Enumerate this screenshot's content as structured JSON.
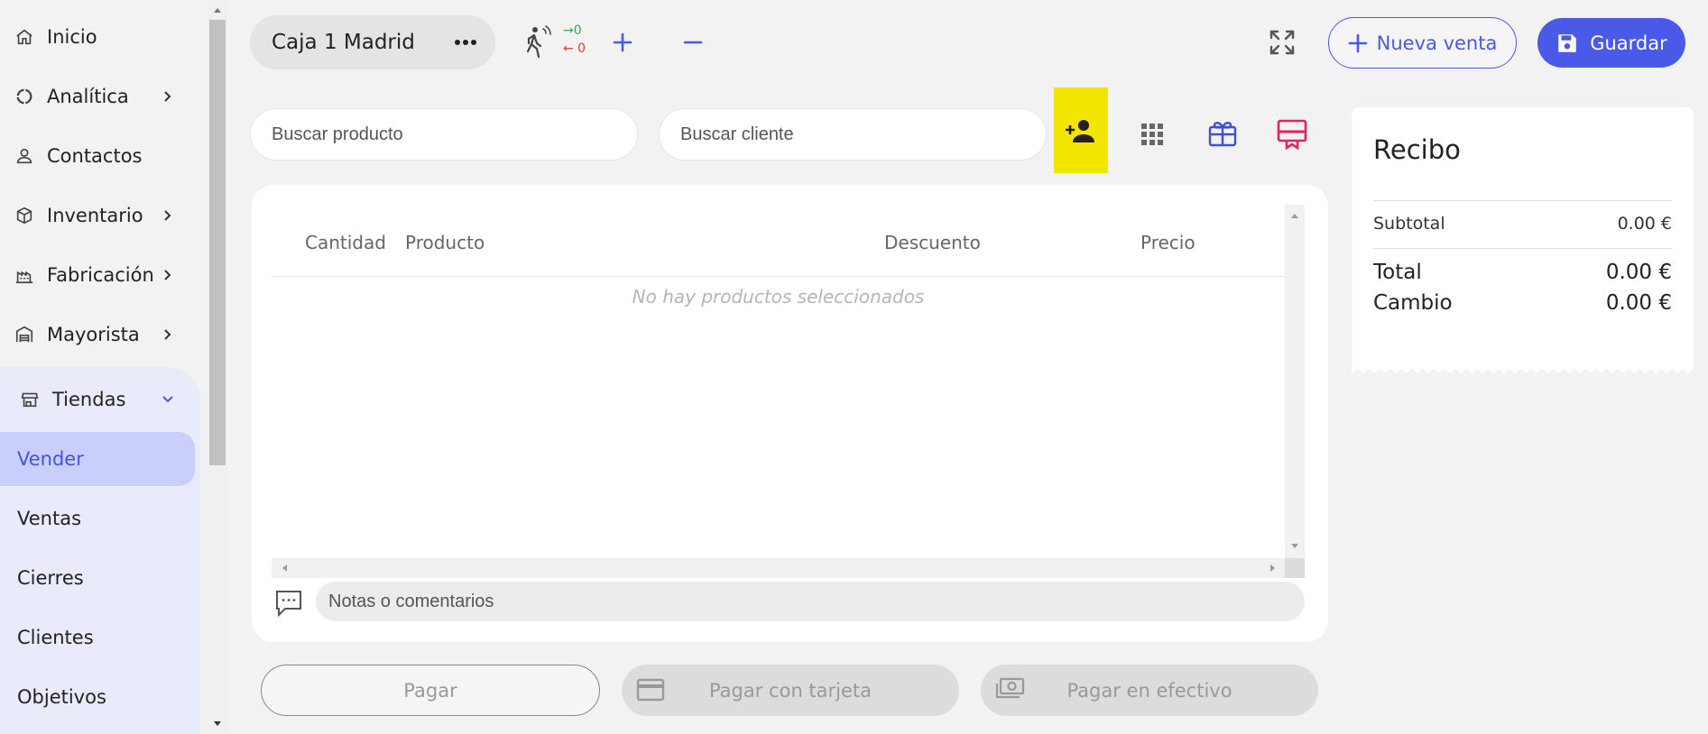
{
  "sidebar": {
    "items": [
      {
        "label": "Inicio",
        "icon": "home-icon"
      },
      {
        "label": "Analítica",
        "icon": "analytics-icon"
      },
      {
        "label": "Contactos",
        "icon": "person-icon"
      },
      {
        "label": "Inventario",
        "icon": "box-icon"
      },
      {
        "label": "Fabricación",
        "icon": "factory-icon"
      },
      {
        "label": "Mayorista",
        "icon": "warehouse-icon"
      }
    ],
    "group": {
      "label": "Tiendas",
      "icon": "store-icon",
      "items": [
        {
          "label": "Vender",
          "active": true
        },
        {
          "label": "Ventas"
        },
        {
          "label": "Cierres"
        },
        {
          "label": "Clientes"
        },
        {
          "label": "Objetivos"
        }
      ]
    }
  },
  "topbar": {
    "register": "Caja 1 Madrid",
    "traffic_in": "→0",
    "traffic_out": "← 0",
    "new_sale": "Nueva venta",
    "save": "Guardar"
  },
  "search": {
    "product_placeholder": "Buscar producto",
    "client_placeholder": "Buscar cliente"
  },
  "table": {
    "columns": [
      "Cantidad",
      "Producto",
      "Descuento",
      "Precio"
    ],
    "empty": "No hay productos seleccionados",
    "notes_placeholder": "Notas o comentarios"
  },
  "payments": {
    "pay": "Pagar",
    "card": "Pagar con tarjeta",
    "cash": "Pagar en efectivo"
  },
  "receipt": {
    "title": "Recibo",
    "subtotal_label": "Subtotal",
    "subtotal_value": "0.00 €",
    "total_label": "Total",
    "total_value": "0.00 €",
    "change_label": "Cambio",
    "change_value": "0.00 €"
  },
  "colors": {
    "accent": "#4a5ae8",
    "active_bg": "#c9cffa",
    "group_bg": "#e9ebfb",
    "highlight": "#f2e600",
    "pink": "#e0245e"
  }
}
